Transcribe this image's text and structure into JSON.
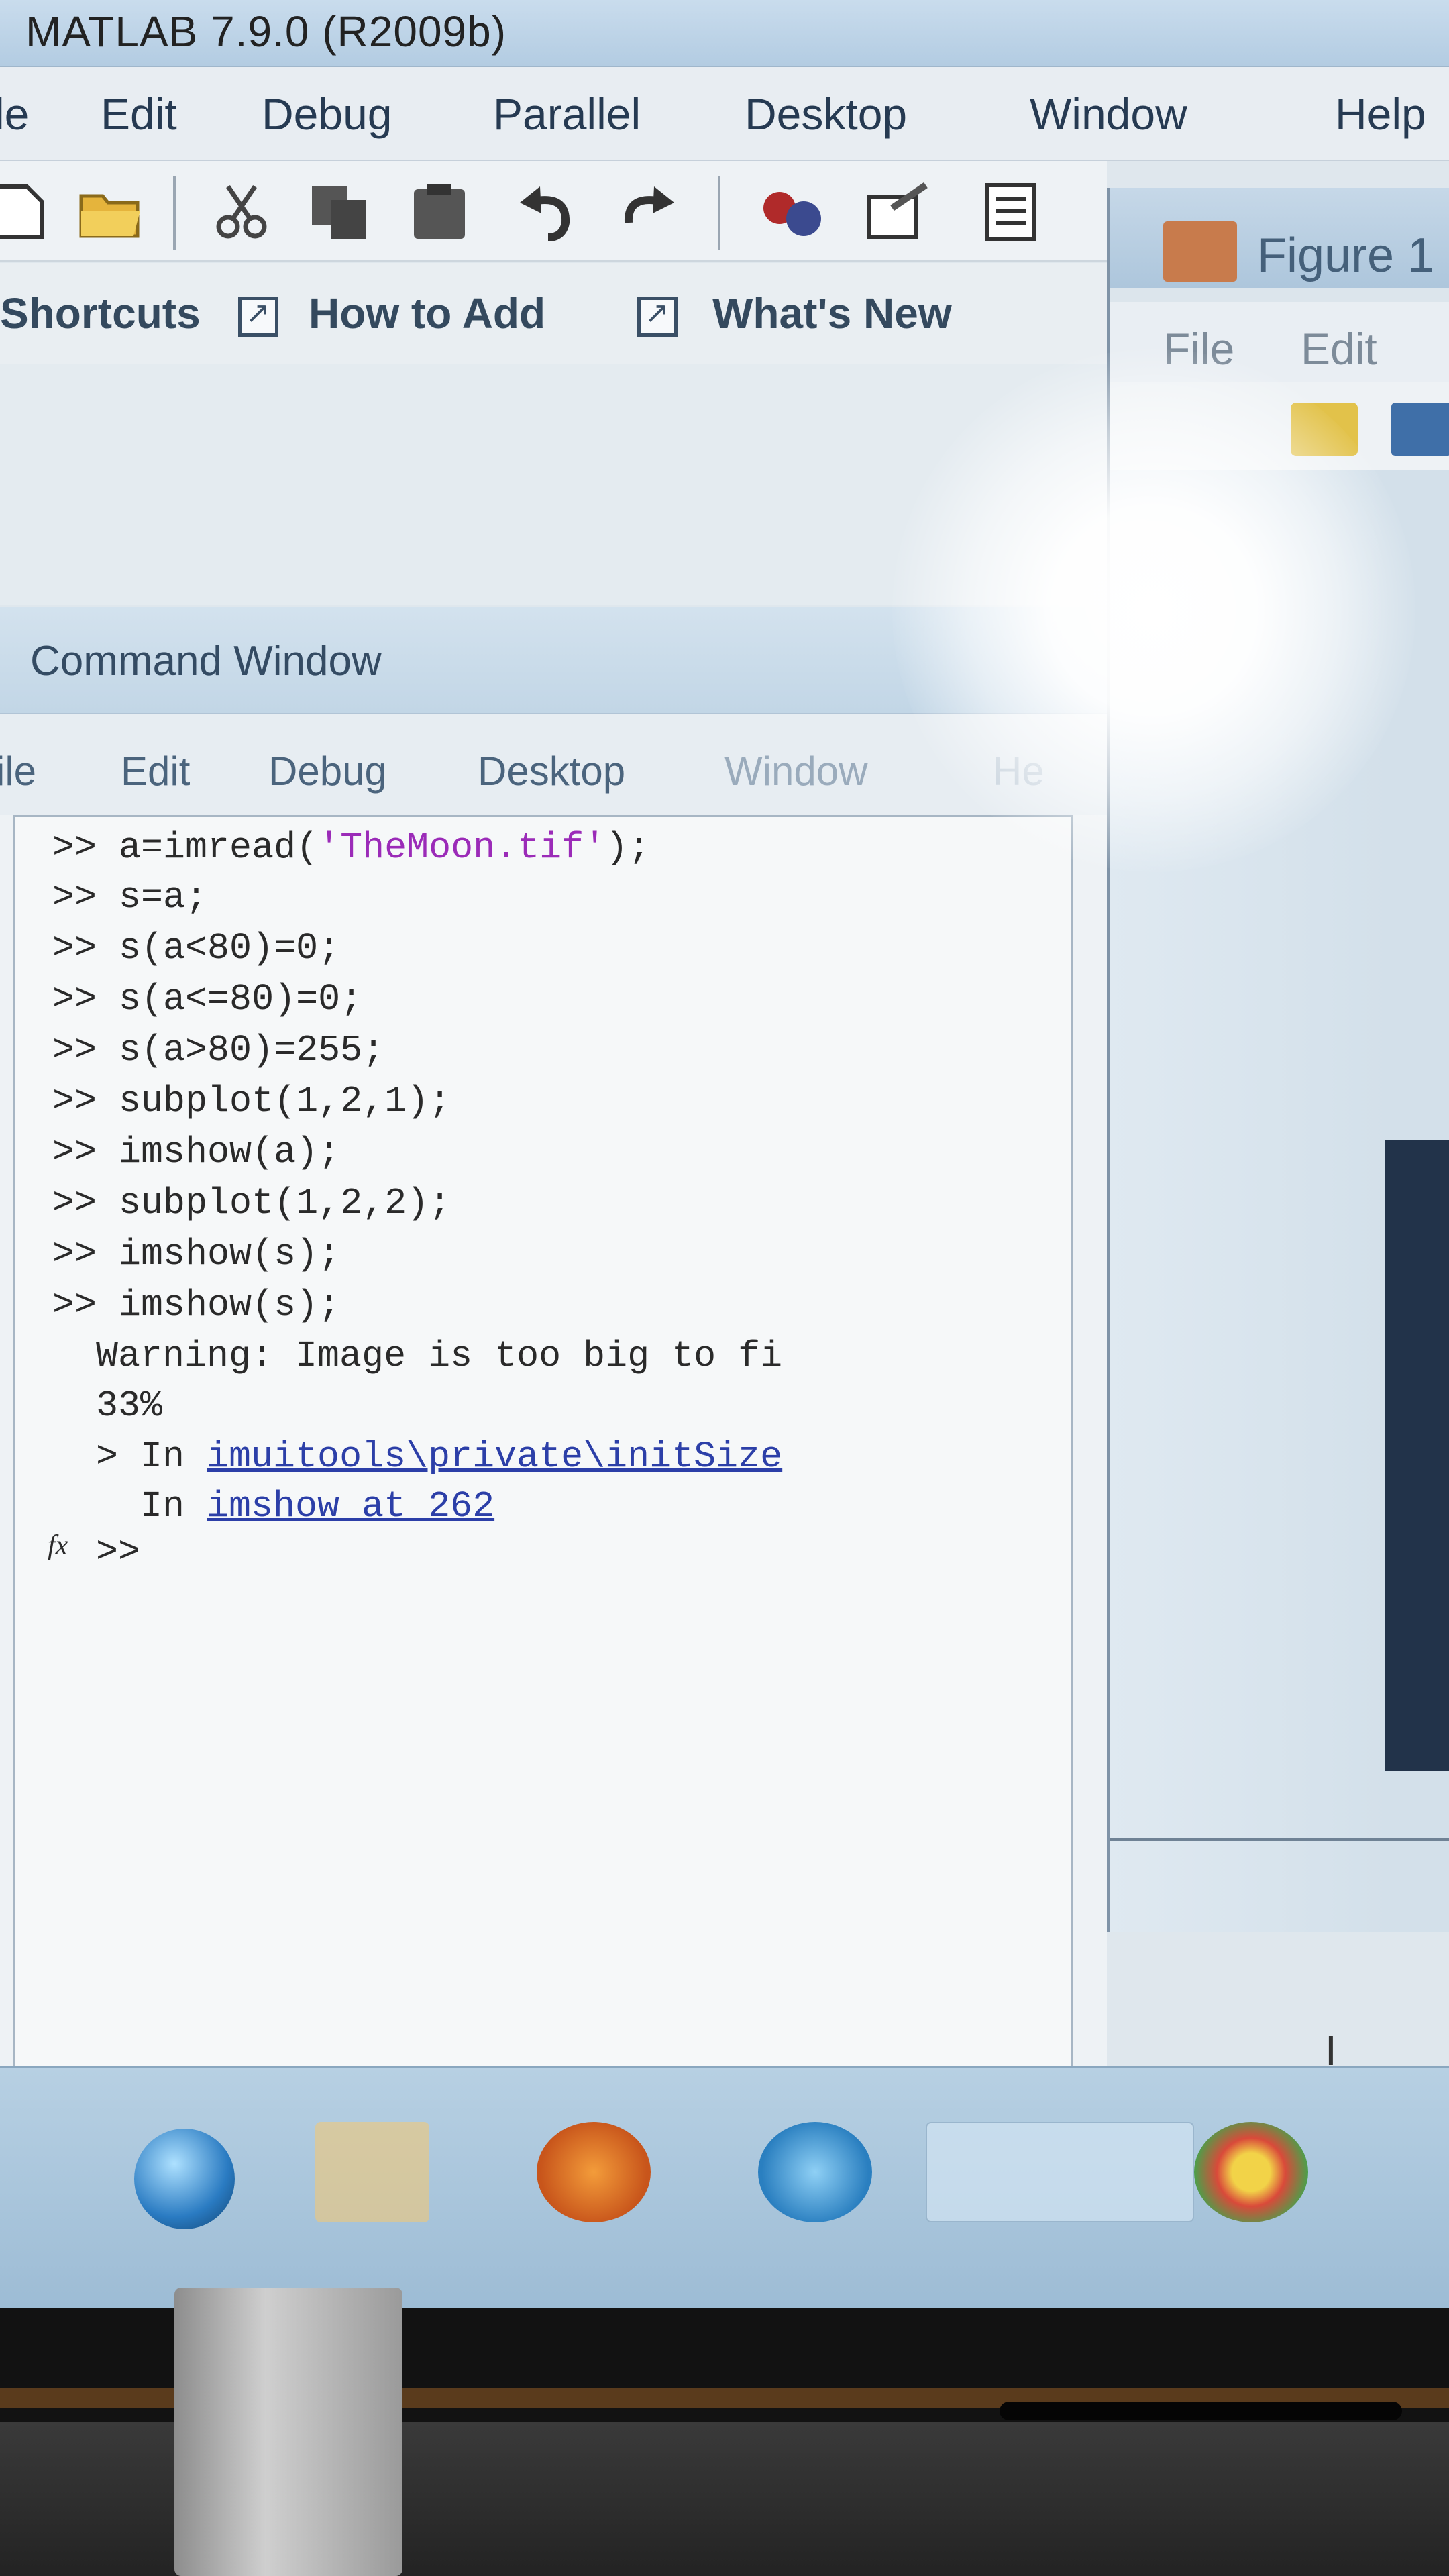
{
  "app": {
    "title": "MATLAB 7.9.0 (R2009b)"
  },
  "main_menu": [
    "le",
    "Edit",
    "Debug",
    "Parallel",
    "Desktop",
    "Window",
    "Help"
  ],
  "shortcuts": {
    "label": "Shortcuts",
    "how_to_add": "How to Add",
    "whats_new": "What's New"
  },
  "figure_window": {
    "title": "Figure 1",
    "menu": [
      "File",
      "Edit"
    ]
  },
  "command_window": {
    "title": "Command Window",
    "menu": [
      "ile",
      "Edit",
      "Debug",
      "Desktop",
      "Window",
      "He"
    ],
    "lines": [
      {
        "prompt": ">> ",
        "code": "a=imread(",
        "string": "'TheMoon.tif'",
        "rest": ");"
      },
      {
        "prompt": ">> ",
        "code": "s=a;"
      },
      {
        "prompt": ">> ",
        "code": "s(a<80)=0;"
      },
      {
        "prompt": ">> ",
        "code": "s(a<=80)=0;"
      },
      {
        "prompt": ">> ",
        "code": "s(a>80)=255;"
      },
      {
        "prompt": ">> ",
        "code": "subplot(1,2,1);"
      },
      {
        "prompt": ">> ",
        "code": "imshow(a);"
      },
      {
        "prompt": ">> ",
        "code": "subplot(1,2,2);"
      },
      {
        "prompt": ">> ",
        "code": "imshow(s);"
      },
      {
        "prompt": ">> ",
        "code": "imshow(s);"
      }
    ],
    "warning": "Warning: Image is too big to fi",
    "percent": "33%",
    "trace1_prefix": "> In ",
    "trace1_link": "imuitools\\private\\initSize",
    "trace2_prefix": "  In ",
    "trace2_link": "imshow at 262",
    "prompt": ">>",
    "fx": "fx"
  },
  "taskbar": {
    "items": [
      "start-orb",
      "folder-icon",
      "firefox-icon",
      "ie-icon",
      "chrome-icon"
    ]
  }
}
